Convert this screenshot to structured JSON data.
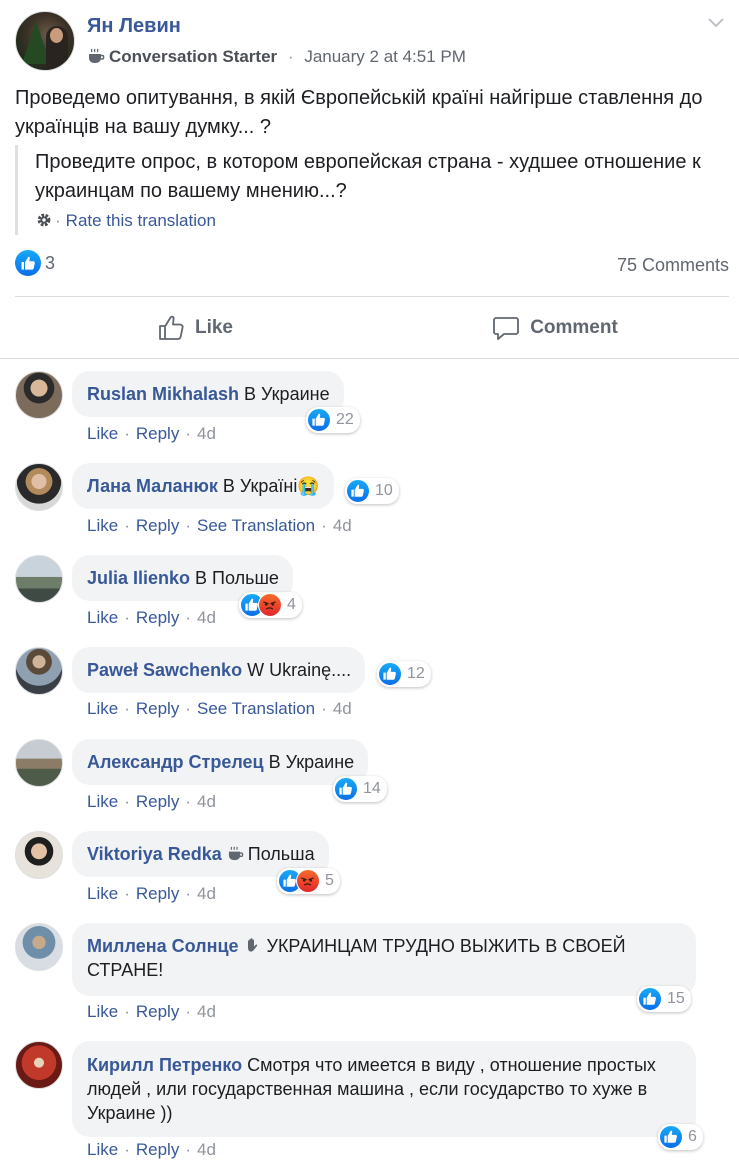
{
  "post": {
    "author": "Ян Левин",
    "badge": "Conversation Starter",
    "timestamp": "January 2 at 4:51 PM",
    "text": "Проведемо опитування, в якій Європейській країні найгірше ставлення до українців на вашу думку... ?",
    "translation": "Проведите опрос, в котором европейская страна - худшее отношение к украинцам по вашему мнению...?",
    "rate_translation": "Rate this translation",
    "rate_separator": "·",
    "like_count": "3",
    "comment_count": "75 Comments",
    "like_button": "Like",
    "comment_button": "Comment"
  },
  "comment_actions": {
    "like": "Like",
    "reply": "Reply",
    "see_translation": "See Translation",
    "sep": "·"
  },
  "comments": [
    {
      "name": "Ruslan Mikhalash",
      "text": "В Украине",
      "reactions": "22",
      "time": "4d"
    },
    {
      "name": "Лана Маланюк",
      "text": "В Україні😭",
      "reactions": "10",
      "time": "4d"
    },
    {
      "name": "Julia Ilienko",
      "text": "В Польше",
      "reactions": "4",
      "time": "4d"
    },
    {
      "name": "Paweł Sawchenko",
      "text": "W Ukrainę....",
      "reactions": "12",
      "time": "4d"
    },
    {
      "name": "Александр Стрелец",
      "text": "В Украине",
      "reactions": "14",
      "time": "4d"
    },
    {
      "name": "Viktoriya Redka",
      "text": "Польша",
      "reactions": "5",
      "time": "4d"
    },
    {
      "name": "Миллена Солнце",
      "text": "УКРАИНЦАМ ТРУДНО ВЫЖИТЬ В СВОЕЙ СТРАНЕ!",
      "reactions": "15",
      "time": "4d"
    },
    {
      "name": "Кирилл Петренко",
      "text": "Смотря что имеется в виду , отношение простых людей , или государственная машина , если государство то хуже в Украине ))",
      "reactions": "6",
      "time": "4d"
    }
  ],
  "colors": {
    "link": "#385898",
    "like_blue": "#1877f2",
    "angry": "#e2262b",
    "bubble": "#f2f3f5"
  }
}
